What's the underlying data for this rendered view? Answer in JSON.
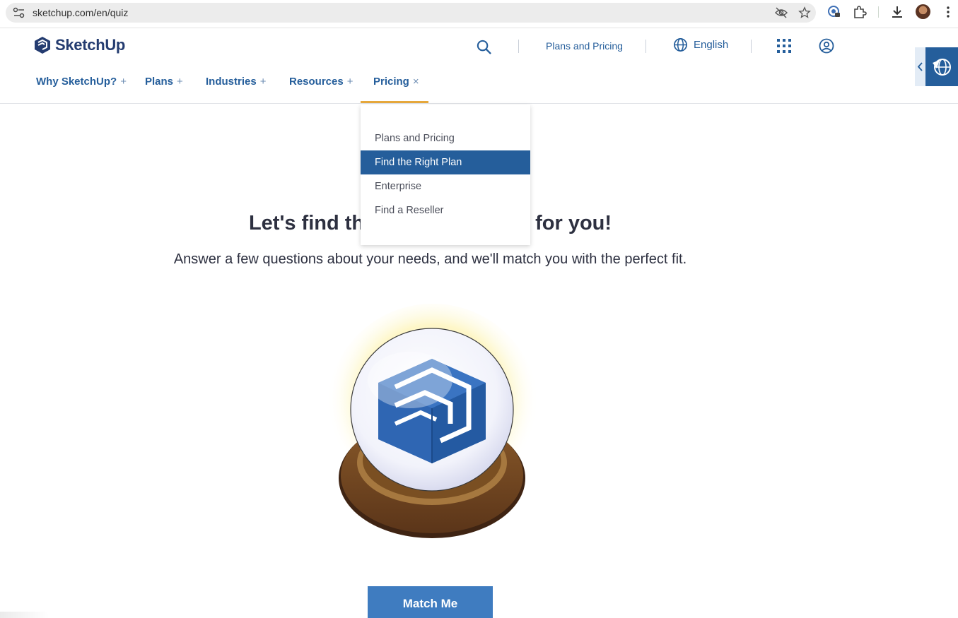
{
  "browser": {
    "url": "sketchup.com/en/quiz",
    "icons": [
      "site-info-icon",
      "eye-off-icon",
      "star-icon",
      "password-manager-icon",
      "extensions-icon",
      "download-icon",
      "avatar",
      "more-vert-icon"
    ]
  },
  "header": {
    "logo_text": "SketchUp",
    "plans_link": "Plans and Pricing",
    "language": "English",
    "icons": [
      "search-icon",
      "globe-icon",
      "apps-grid-icon",
      "account-icon"
    ]
  },
  "nav": {
    "items": [
      {
        "label": "Why SketchUp?",
        "symbol": "+"
      },
      {
        "label": "Plans",
        "symbol": "+"
      },
      {
        "label": "Industries",
        "symbol": "+"
      },
      {
        "label": "Resources",
        "symbol": "+"
      },
      {
        "label": "Pricing",
        "symbol": "×"
      }
    ]
  },
  "dropdown": {
    "items": [
      "Plans and Pricing",
      "Find the Right Plan",
      "Enterprise",
      "Find a Reseller"
    ],
    "active": "Find the Right Plan"
  },
  "main": {
    "headline_left": "Let's find th",
    "headline_right": "for you!",
    "subline": "Answer a few questions about your needs, and we'll match you with the perfect fit.",
    "cta": "Match Me"
  },
  "colors": {
    "brand_blue": "#255e9b",
    "accent_orange": "#e7a93c",
    "button_blue": "#3f7cc0",
    "text_dark": "#2d3040"
  }
}
